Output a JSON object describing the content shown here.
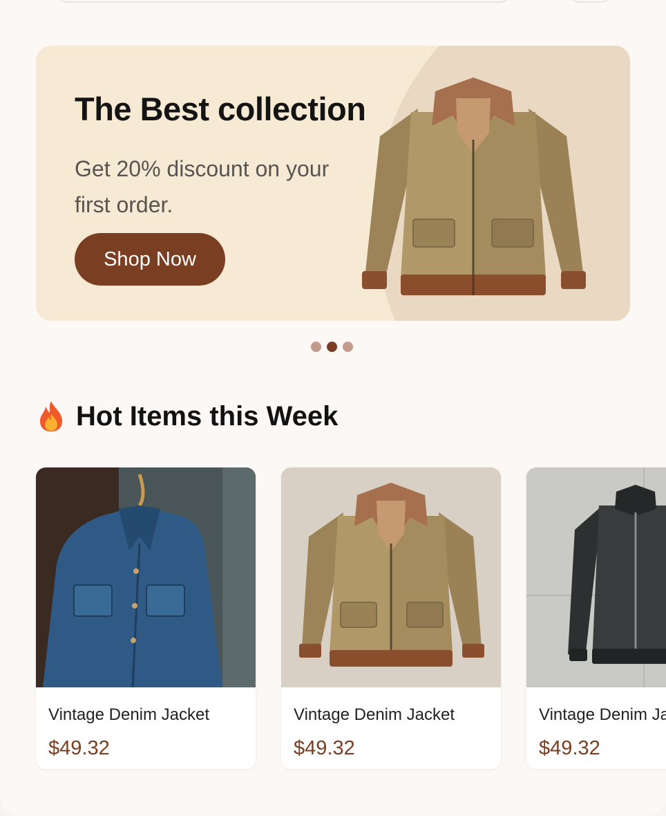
{
  "banner": {
    "title": "The Best collection",
    "subtitle": "Get 20% discount on your first order.",
    "button_label": "Shop Now",
    "image_icon": "tan-bomber-jacket"
  },
  "carousel": {
    "slides": 3,
    "active_index": 1
  },
  "hot_items": {
    "title": "Hot Items this Week",
    "icon": "fire-icon",
    "products": [
      {
        "name": "Vintage Denim Jacket",
        "price": "$49.32",
        "image": "denim-jacket"
      },
      {
        "name": "Vintage Denim Jacket",
        "price": "$49.32",
        "image": "tan-bomber-jacket"
      },
      {
        "name": "Vintage Denim Jacket",
        "price": "$49.32",
        "image": "black-bomber-jacket"
      }
    ]
  },
  "colors": {
    "brand": "#7a3f22",
    "banner_bg": "#f6ead5",
    "price": "#7a3f22"
  }
}
